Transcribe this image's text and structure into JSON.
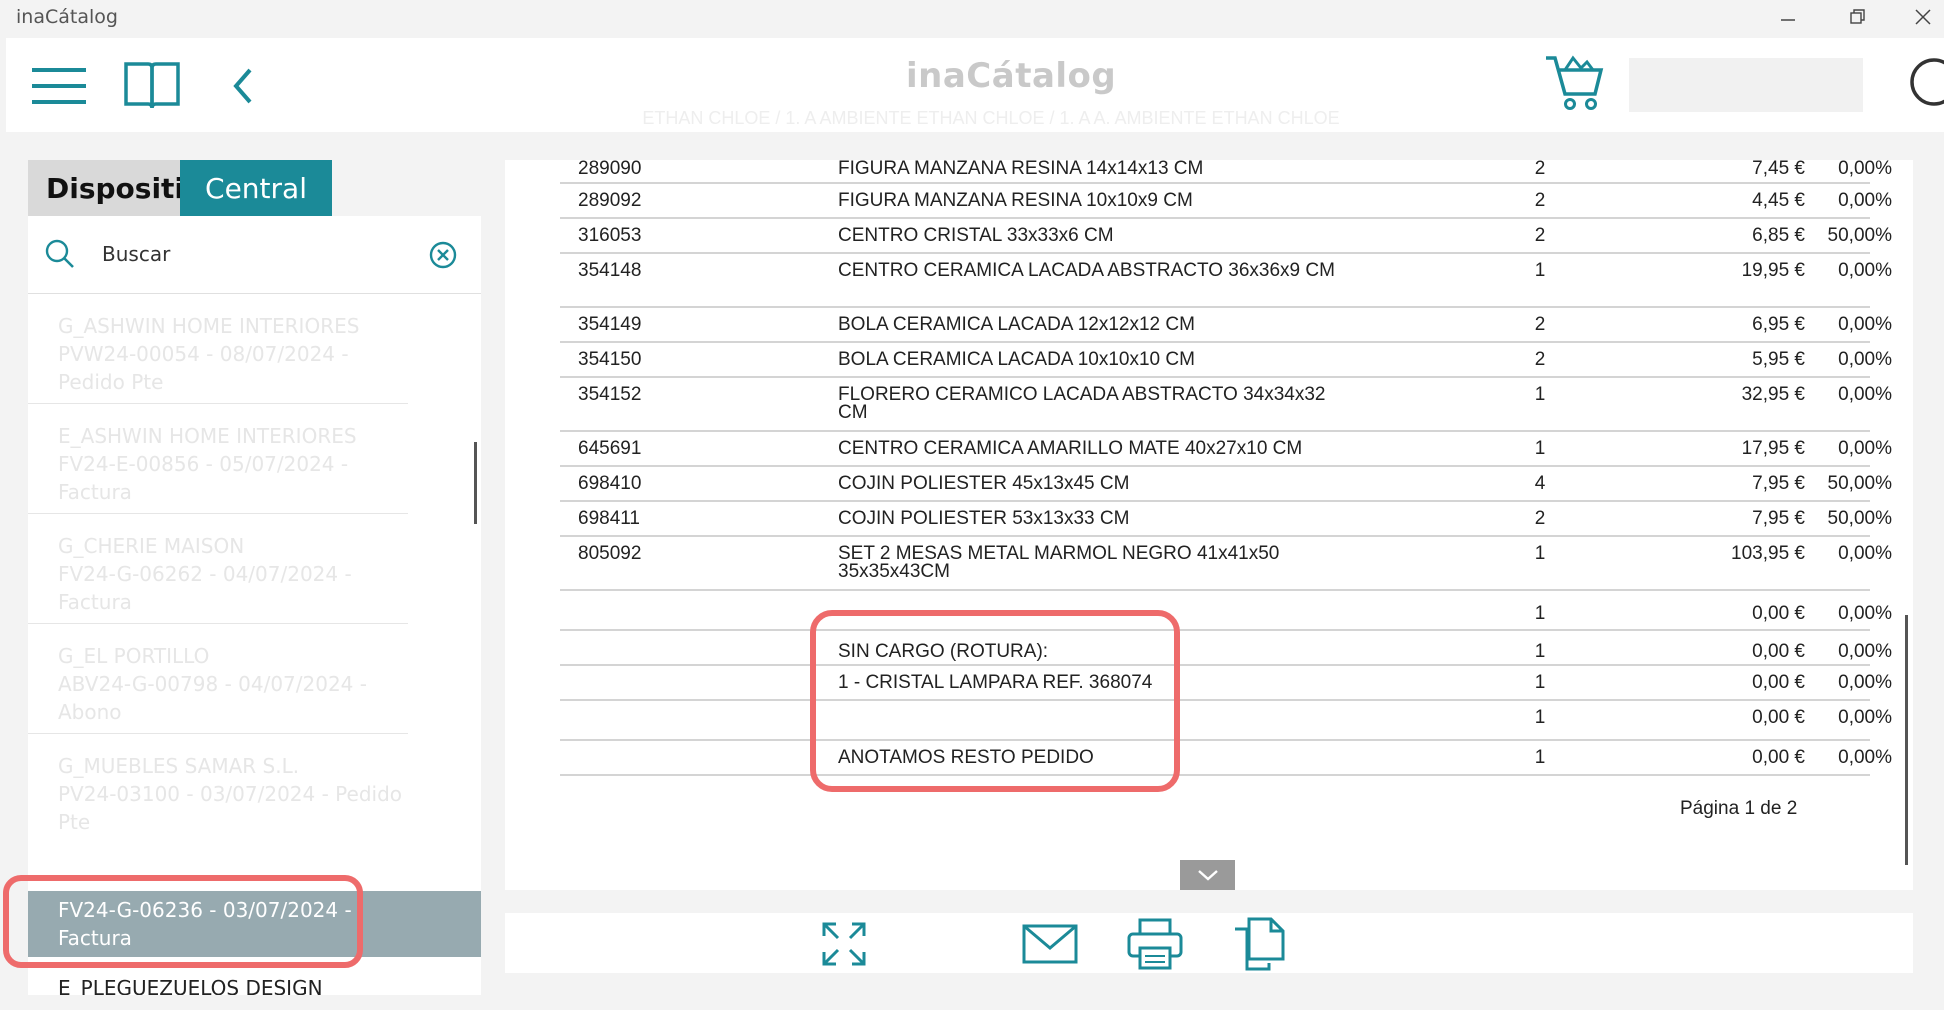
{
  "window": {
    "title": "inaCátalog"
  },
  "header": {
    "logo": "inaCátalog",
    "subtitle": "ETHAN CHLOE / 1. A AMBIENTE ETHAN CHLOE / 1. A A. AMBIENTE ETHAN CHLOE"
  },
  "left_panel": {
    "tabs": [
      {
        "label": "Dispositivo"
      },
      {
        "label": "Central"
      }
    ],
    "search": {
      "placeholder": "Buscar"
    },
    "items": [
      {
        "line1": "G_ASHWIN HOME INTERIORES",
        "line2": "PVW24-00054 - 08/07/2024 -",
        "line3": "Pedido Pte"
      },
      {
        "line1": "E_ASHWIN HOME INTERIORES",
        "line2": "FV24-E-00856 - 05/07/2024 -",
        "line3": "Factura"
      },
      {
        "line1": "G_CHERIE MAISON",
        "line2": "FV24-G-06262 - 04/07/2024 -",
        "line3": "Factura"
      },
      {
        "line1": "G_EL PORTILLO",
        "line2": "ABV24-G-00798 - 04/07/2024 -",
        "line3": "Abono"
      },
      {
        "line1": "G_MUEBLES SAMAR S.L.",
        "line2": "PV24-03100 - 03/07/2024 - Pedido",
        "line3": "Pte"
      }
    ],
    "selected": {
      "line1": "FV24-G-06236 - 03/07/2024 -",
      "line2": "Factura"
    },
    "next_item": "E_PLEGUEZUELOS DESIGN"
  },
  "document": {
    "rows": [
      {
        "code": "289090",
        "desc": "FIGURA MANZANA RESINA 14x14x13 CM",
        "qty": "2",
        "price": "7,45 €",
        "disc": "0,00%"
      },
      {
        "code": "289092",
        "desc": "FIGURA MANZANA RESINA 10x10x9 CM",
        "qty": "2",
        "price": "4,45 €",
        "disc": "0,00%"
      },
      {
        "code": "316053",
        "desc": "CENTRO CRISTAL 33x33x6 CM",
        "qty": "2",
        "price": "6,85 €",
        "disc": "50,00%"
      },
      {
        "code": "354148",
        "desc": "CENTRO CERAMICA LACADA ABSTRACTO 36x36x9 CM",
        "qty": "1",
        "price": "19,95 €",
        "disc": "0,00%"
      },
      {
        "code": "354149",
        "desc": "BOLA CERAMICA LACADA 12x12x12 CM",
        "qty": "2",
        "price": "6,95 €",
        "disc": "0,00%"
      },
      {
        "code": "354150",
        "desc": "BOLA CERAMICA LACADA 10x10x10 CM",
        "qty": "2",
        "price": "5,95 €",
        "disc": "0,00%"
      },
      {
        "code": "354152",
        "desc": "FLORERO CERAMICO LACADA ABSTRACTO 34x34x32 CM",
        "qty": "1",
        "price": "32,95 €",
        "disc": "0,00%"
      },
      {
        "code": "645691",
        "desc": "CENTRO CERAMICA AMARILLO MATE 40x27x10 CM",
        "qty": "1",
        "price": "17,95 €",
        "disc": "0,00%"
      },
      {
        "code": "698410",
        "desc": "COJIN POLIESTER 45x13x45 CM",
        "qty": "4",
        "price": "7,95 €",
        "disc": "50,00%"
      },
      {
        "code": "698411",
        "desc": "COJIN POLIESTER 53x13x33 CM",
        "qty": "2",
        "price": "7,95 €",
        "disc": "50,00%"
      },
      {
        "code": "805092",
        "desc": "SET 2 MESAS METAL MARMOL NEGRO 41x41x50 35x35x43CM",
        "qty": "1",
        "price": "103,95 €",
        "disc": "0,00%"
      },
      {
        "code": "",
        "desc": "",
        "qty": "1",
        "price": "0,00 €",
        "disc": "0,00%"
      },
      {
        "code": "",
        "desc": "SIN CARGO (ROTURA):",
        "qty": "1",
        "price": "0,00 €",
        "disc": "0,00%"
      },
      {
        "code": "",
        "desc": "1 - CRISTAL LAMPARA REF. 368074",
        "qty": "1",
        "price": "0,00 €",
        "disc": "0,00%"
      },
      {
        "code": "",
        "desc": "",
        "qty": "1",
        "price": "0,00 €",
        "disc": "0,00%"
      },
      {
        "code": "",
        "desc": "ANOTAMOS RESTO PEDIDO",
        "qty": "1",
        "price": "0,00 €",
        "disc": "0,00%"
      }
    ],
    "page_label": "Página 1 de 2"
  },
  "icons": {
    "menu": "hamburger-icon",
    "catalog": "book-icon",
    "back": "chevron-left-icon",
    "cart": "cart-icon",
    "search": "search-icon"
  },
  "colors": {
    "accent": "#1b8a98",
    "selected": "#97aab0",
    "highlight": "#ee6b6b"
  }
}
